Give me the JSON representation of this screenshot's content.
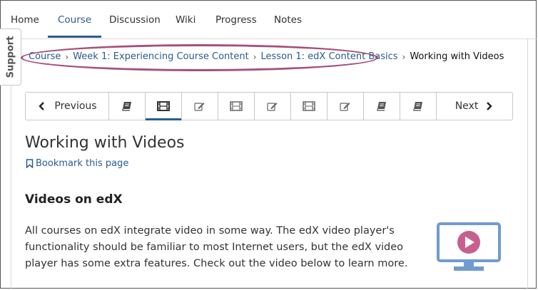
{
  "nav": {
    "tabs": [
      {
        "label": "Home"
      },
      {
        "label": "Course"
      },
      {
        "label": "Discussion"
      },
      {
        "label": "Wiki"
      },
      {
        "label": "Progress"
      },
      {
        "label": "Notes"
      }
    ],
    "active_tab": "Course"
  },
  "support": {
    "label": "Support"
  },
  "breadcrumb": {
    "items": [
      "Course",
      "Week 1: Experiencing Course Content",
      "Lesson 1: edX Content Basics"
    ],
    "current": "Working with Videos"
  },
  "sequence": {
    "prev_label": "Previous",
    "next_label": "Next",
    "units": [
      "book-icon",
      "video-icon",
      "problem-icon",
      "video-icon",
      "problem-icon",
      "video-icon",
      "problem-icon",
      "book-icon",
      "book-icon"
    ],
    "active_index": 1
  },
  "page": {
    "title": "Working with Videos",
    "bookmark_label": "Bookmark this page",
    "section_heading": "Videos on edX",
    "paragraph": "All courses on edX integrate video in some way. The edX video player's functionality should be familiar to most Internet users, but the edX video player has some extra features. Check out the video below to learn more."
  },
  "colors": {
    "accent": "#2a5c8f",
    "highlight_oval": "#a5507e",
    "monitor_blue": "#6f9bd1",
    "play_pink": "#c7608f"
  }
}
